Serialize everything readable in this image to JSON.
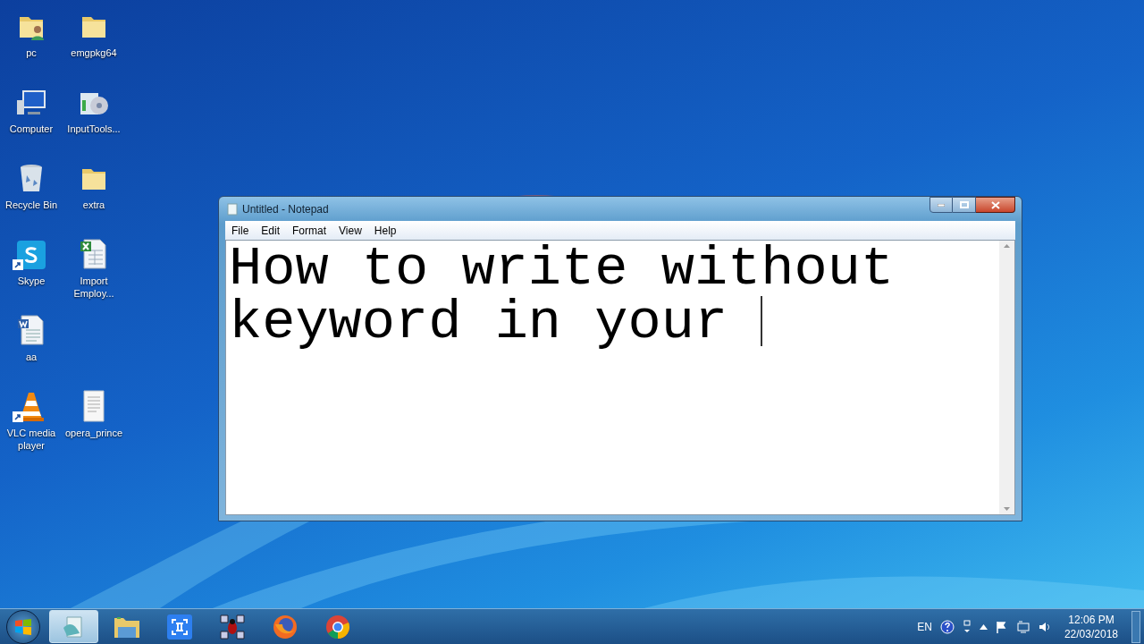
{
  "desktop_rows": [
    [
      {
        "label": "pc",
        "kind": "user-folder",
        "shortcut": false
      },
      {
        "label": "emgpkg64",
        "kind": "folder",
        "shortcut": false
      }
    ],
    [
      {
        "label": "Computer",
        "kind": "computer",
        "shortcut": false
      },
      {
        "label": "InputTools...",
        "kind": "installer",
        "shortcut": false
      }
    ],
    [
      {
        "label": "Recycle Bin",
        "kind": "recycle-bin",
        "shortcut": false
      },
      {
        "label": "extra",
        "kind": "folder",
        "shortcut": false
      }
    ],
    [
      {
        "label": "Skype",
        "kind": "skype",
        "shortcut": true
      },
      {
        "label": "Import Employ...",
        "kind": "spreadsheet",
        "shortcut": false
      }
    ],
    [
      {
        "label": "aa",
        "kind": "word-doc",
        "shortcut": false
      }
    ],
    [
      {
        "label": "VLC media player",
        "kind": "cone",
        "shortcut": true
      },
      {
        "label": "opera_prince",
        "kind": "document",
        "shortcut": false
      }
    ]
  ],
  "notepad": {
    "title": "Untitled - Notepad",
    "menu": [
      "File",
      "Edit",
      "Format",
      "View",
      "Help"
    ],
    "text": "How to write without keyword in your "
  },
  "taskbar": {
    "apps": [
      {
        "kind": "notepad",
        "selected": true
      },
      {
        "kind": "explorer",
        "selected": false
      },
      {
        "kind": "capture",
        "selected": false
      },
      {
        "kind": "bug",
        "selected": false
      },
      {
        "kind": "firefox",
        "selected": false
      },
      {
        "kind": "chrome",
        "selected": false
      }
    ],
    "language": "EN",
    "time": "12:06 PM",
    "date": "22/03/2018"
  }
}
